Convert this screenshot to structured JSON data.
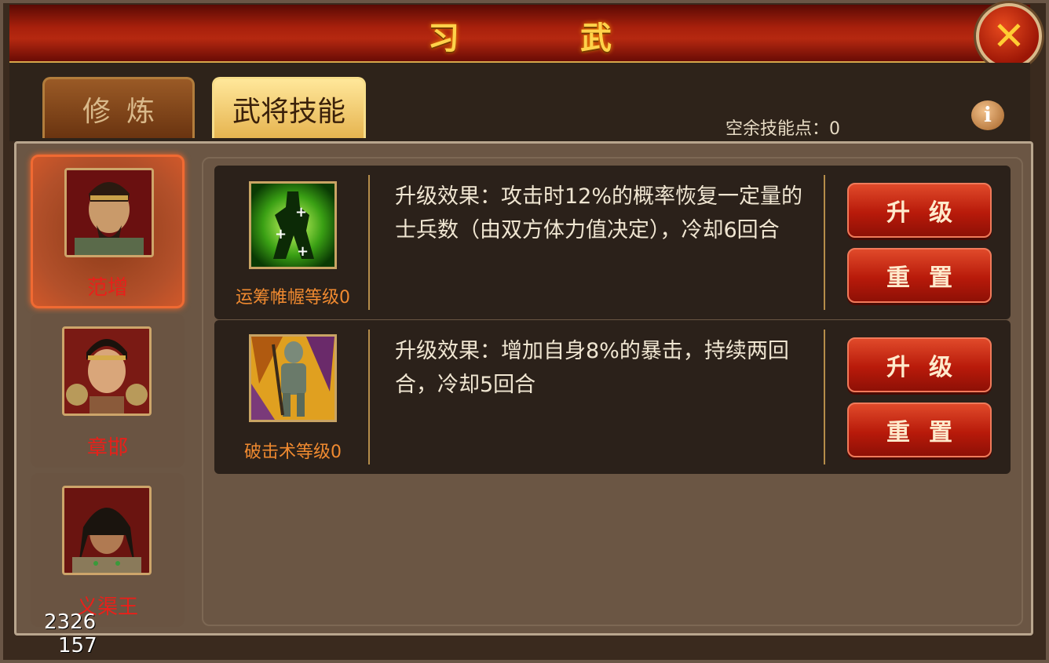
{
  "window": {
    "title": "习 武"
  },
  "tabs": [
    {
      "label": "修炼"
    },
    {
      "label": "武将技能"
    }
  ],
  "skill_points": {
    "label": "空余技能点：0"
  },
  "heroes": [
    {
      "name": "范增"
    },
    {
      "name": "章邯"
    },
    {
      "name": "义渠王"
    }
  ],
  "skills": [
    {
      "level_label": "运筹帷幄等级0",
      "description": "升级效果：攻击时12%的概率恢复一定量的士兵数（由双方体力值决定），冷却6回合",
      "upgrade_label": "升级",
      "reset_label": "重置",
      "icon": "green-energy-figure-icon"
    },
    {
      "level_label": "破击术等级0",
      "description": "升级效果：增加自身8%的暴击，持续两回合，冷却5回合",
      "upgrade_label": "升级",
      "reset_label": "重置",
      "icon": "armored-knight-icon"
    }
  ],
  "debug": {
    "line1": "2326",
    "line2": "157"
  }
}
